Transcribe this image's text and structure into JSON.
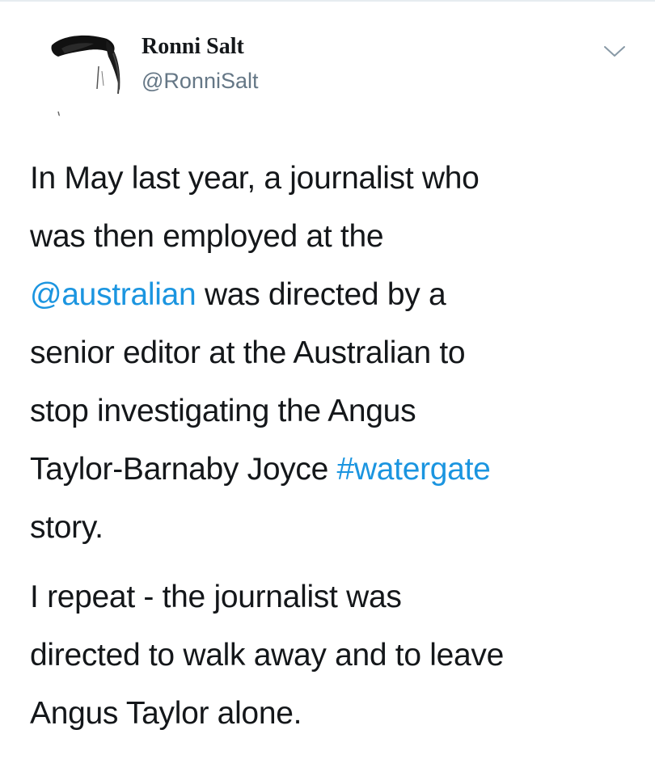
{
  "tweet": {
    "author": {
      "name": "Ronni Salt",
      "handle": "@RonniSalt"
    },
    "paragraphs": [
      [
        [
          {
            "text": "In May last year, a journalist who"
          }
        ],
        [
          {
            "text": "was then employed at the"
          }
        ],
        [
          {
            "text": "@australian",
            "link": true
          },
          {
            "text": " was directed by a"
          }
        ],
        [
          {
            "text": "senior editor at the Australian to"
          }
        ],
        [
          {
            "text": "stop investigating the Angus"
          }
        ],
        [
          {
            "text": "Taylor-Barnaby Joyce "
          },
          {
            "text": "#watergate",
            "link": true
          }
        ],
        [
          {
            "text": "story."
          }
        ]
      ],
      [
        [
          {
            "text": "I repeat - the journalist was"
          }
        ],
        [
          {
            "text": "directed to walk away and to leave"
          }
        ],
        [
          {
            "text": "Angus Taylor alone."
          }
        ]
      ]
    ]
  },
  "icons": {
    "avatar": "avatar-image",
    "menu": "chevron-down-icon"
  },
  "colors": {
    "link": "#1b95e0",
    "text": "#14171a",
    "secondary": "#657786"
  }
}
